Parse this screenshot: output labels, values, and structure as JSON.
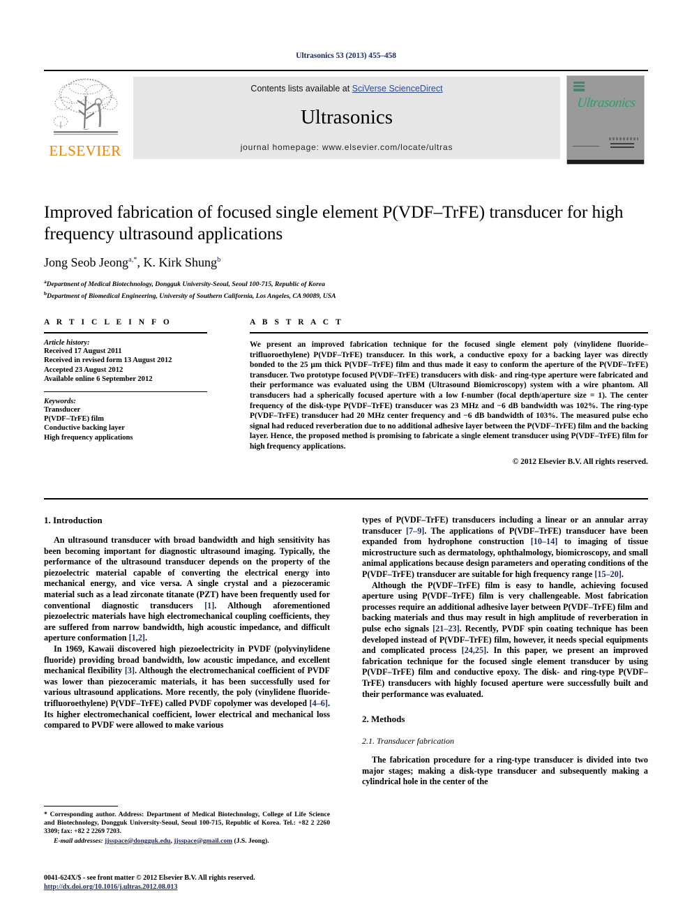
{
  "running_head": "Ultrasonics 53 (2013) 455–458",
  "masthead": {
    "contents_prefix": "Contents lists available at ",
    "contents_link": "SciVerse ScienceDirect",
    "journal_title": "Ultrasonics",
    "homepage": "journal homepage: www.elsevier.com/locate/ultras",
    "publisher": "ELSEVIER",
    "cover_title": "Ultrasonics",
    "link_color": "#2b4a9b",
    "publisher_color": "#ef8200",
    "cover_accent": "#2e9e6b"
  },
  "article": {
    "title": "Improved fabrication of focused single element P(VDF–TrFE) transducer for high frequency ultrasound applications",
    "authors": [
      {
        "name": "Jong Seob Jeong",
        "marks": "a,*"
      },
      {
        "name": "K. Kirk Shung",
        "marks": "b"
      }
    ],
    "affiliations": [
      {
        "mark": "a",
        "text": "Department of Medical Biotechnology, Dongguk University-Seoul, Seoul 100-715, Republic of Korea"
      },
      {
        "mark": "b",
        "text": "Department of Biomedical Engineering, University of Southern California, Los Angeles, CA 90089, USA"
      }
    ]
  },
  "article_info": {
    "heading": "A R T I C L E   I N F O",
    "history_label": "Article history:",
    "history": [
      "Received 17 August 2011",
      "Received in revised form 13 August 2012",
      "Accepted 23 August 2012",
      "Available online 6 September 2012"
    ],
    "keywords_label": "Keywords:",
    "keywords": [
      "Transducer",
      "P(VDF–TrFE) film",
      "Conductive backing layer",
      "High frequency applications"
    ]
  },
  "abstract": {
    "heading": "A B S T R A C T",
    "text": "We present an improved fabrication technique for the focused single element poly (vinylidene fluoride–trifluoroethylene) P(VDF–TrFE) transducer. In this work, a conductive epoxy for a backing layer was directly bonded to the 25 μm thick P(VDF–TrFE) film and thus made it easy to conform the aperture of the P(VDF–TrFE) transducer. Two prototype focused P(VDF–TrFE) transducers with disk- and ring-type aperture were fabricated and their performance was evaluated using the UBM (Ultrasound Biomicroscopy) system with a wire phantom. All transducers had a spherically focused aperture with a low f-number (focal depth/aperture size = 1). The center frequency of the disk-type P(VDF–TrFE) transducer was 23 MHz and −6 dB bandwidth was 102%. The ring-type P(VDF–TrFE) transducer had 20 MHz center frequency and −6 dB bandwidth of 103%. The measured pulse echo signal had reduced reverberation due to no additional adhesive layer between the P(VDF–TrFE) film and the backing layer. Hence, the proposed method is promising to fabricate a single element transducer using P(VDF–TrFE) film for high frequency applications.",
    "copyright": "© 2012 Elsevier B.V. All rights reserved."
  },
  "body": {
    "left": {
      "section_heading": "1. Introduction",
      "p1_a": "An ultrasound transducer with broad bandwidth and high sensitivity has been becoming important for diagnostic ultrasound imaging. Typically, the performance of the ultrasound transducer depends on the property of the piezoelectric material capable of converting the electrical energy into mechanical energy, and vice versa. A single crystal and a piezoceramic material such as a lead zirconate titanate (PZT) have been frequently used for conventional diagnostic transducers ",
      "p1_ref1": "[1]",
      "p1_b": ". Although aforementioned piezoelectric materials have high electromechanical coupling coefficients, they are suffered from narrow bandwidth, high acoustic impedance, and difficult aperture conformation ",
      "p1_ref2": "[1,2]",
      "p1_c": ".",
      "p2_a": "In 1969, Kawaii discovered high piezoelectricity in PVDF (polyvinylidene fluoride) providing broad bandwidth, low acoustic impedance, and excellent mechanical flexibility ",
      "p2_ref1": "[3]",
      "p2_b": ". Although the electromechanical coefficient of PVDF was lower than piezoceramic materials, it has been successfully used for various ultrasound applications. More recently, the poly (vinylidene fluoride-trifluoroethylene) P(VDF–TrFE) called PVDF copolymer was developed ",
      "p2_ref2": "[4–6]",
      "p2_c": ". Its higher electromechanical coefficient, lower electrical and mechanical loss compared to PVDF were allowed to make various"
    },
    "right": {
      "p3_a": "types of P(VDF–TrFE) transducers including a linear or an annular array transducer ",
      "p3_ref1": "[7–9]",
      "p3_b": ". The applications of P(VDF–TrFE) transducer have been expanded from hydrophone construction ",
      "p3_ref2": "[10–14]",
      "p3_c": " to imaging of tissue microstructure such as dermatology, ophthalmology, biomicroscopy, and small animal applications because design parameters and operating conditions of the P(VDF–TrFE) transducer are suitable for high frequency range ",
      "p3_ref3": "[15–20]",
      "p3_d": ".",
      "p4_a": "Although the P(VDF–TrFE) film is easy to handle, achieving focused aperture using P(VDF–TrFE) film is very challengeable. Most fabrication processes require an additional adhesive layer between P(VDF–TrFE) film and backing materials and thus may result in high amplitude of reverberation in pulse echo signals ",
      "p4_ref1": "[21–23]",
      "p4_b": ". Recently, PVDF spin coating technique has been developed instead of P(VDF–TrFE) film, however, it needs special equipments and complicated process ",
      "p4_ref2": "[24,25]",
      "p4_c": ". In this paper, we present an improved fabrication technique for the focused single element transducer by using P(VDF–TrFE) film and conductive epoxy. The disk- and ring-type P(VDF–TrFE) transducers with highly focused aperture were successfully built and their performance was evaluated.",
      "section_heading": "2. Methods",
      "subsection_heading": "2.1. Transducer fabrication",
      "p5": "The fabrication procedure for a ring-type transducer is divided into two major stages; making a disk-type transducer and subsequently making a cylindrical hole in the center of the"
    }
  },
  "footnote": {
    "corresponding": "* Corresponding author. Address: Department of Medical Biotechnology, College of Life Science and Biotechnology, Dongguk University-Seoul, Seoul 100-715, Republic of Korea. Tel.: +82 2 2260 3309; fax: +82 2 2269 7203.",
    "email_label": "E-mail addresses:",
    "email1": "jjsspace@dongguk.edu",
    "email2": "jjsspace@gmail.com",
    "email_suffix": "(J.S. Jeong)."
  },
  "imprint": {
    "line1": "0041-624X/$ - see front matter © 2012 Elsevier B.V. All rights reserved.",
    "doi": "http://dx.doi.org/10.1016/j.ultras.2012.08.013"
  }
}
